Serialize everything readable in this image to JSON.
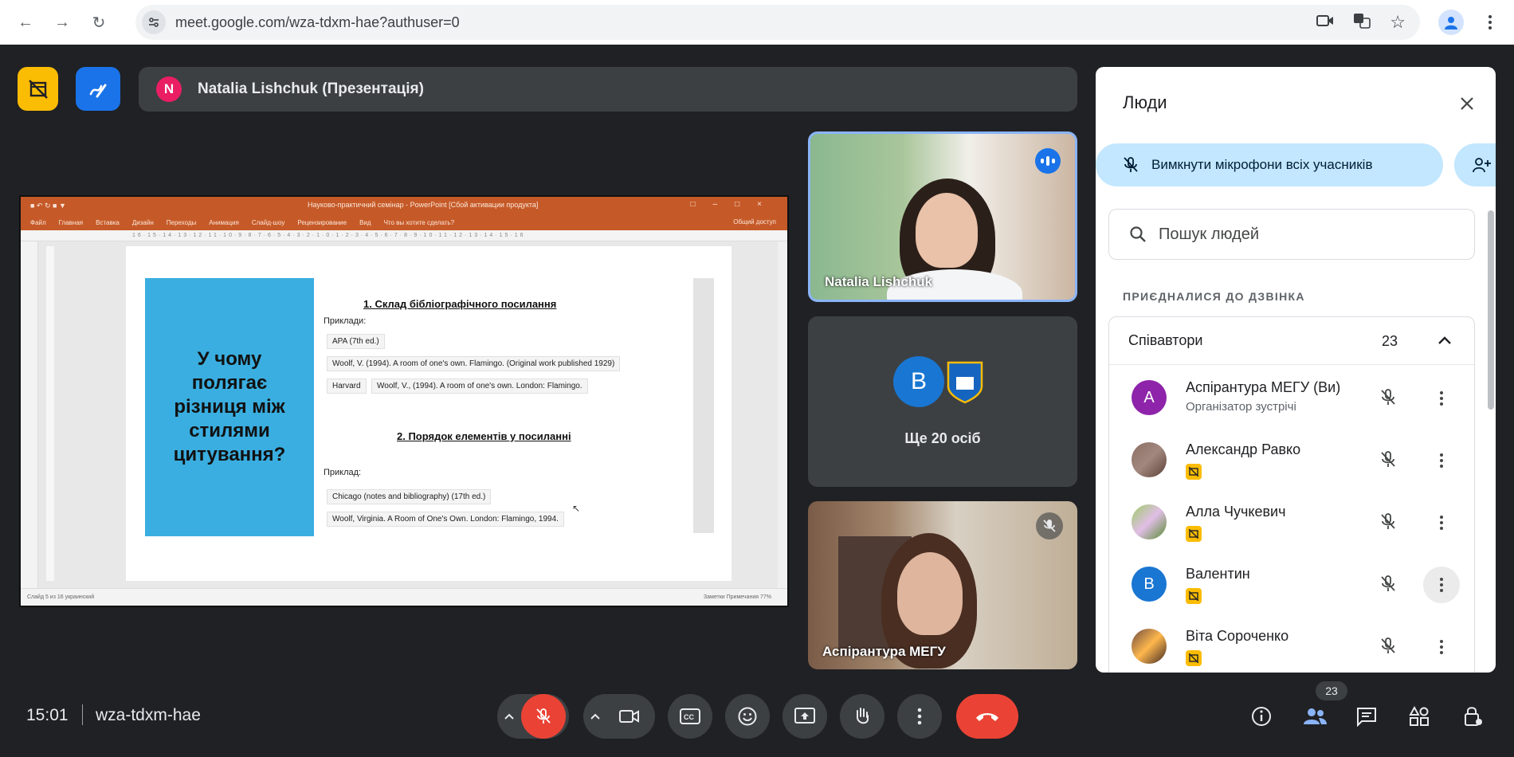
{
  "browser": {
    "url": "meet.google.com/wza-tdxm-hae?authuser=0"
  },
  "presenter": {
    "avatar_letter": "N",
    "label": "Natalia Lishchuk (Презентація)"
  },
  "slide": {
    "ppt_title": "Науково-практичний семінар - PowerPoint [Сбой активации продукта]",
    "ribbon_tabs": [
      "Файл",
      "Главная",
      "Вставка",
      "Дизайн",
      "Переходы",
      "Анимация",
      "Слайд-шоу",
      "Рецензирование",
      "Вид",
      "Что вы хотите сделать?"
    ],
    "share_label": "Общий доступ",
    "status_left": "Слайд 5 из 16   украинский",
    "status_right": "Заметки   Примечания   77%",
    "left_text": "У чому полягає різниця між стилями цитування?",
    "heading1": "1. Склад бібліографічного посилання",
    "examples_label": "Приклади:",
    "apa_label": "APA (7th ed.)",
    "apa_example": "Woolf, V. (1994). A room of one's own. Flamingo. (Original work published 1929)",
    "harvard_label": "Harvard",
    "harvard_example": "Woolf, V., (1994). A room of one's own. London: Flamingo.",
    "heading2": "2. Порядок елементів у посиланні",
    "example_label": "Приклад:",
    "chicago_label": "Chicago (notes and bibliography) (17th ed.)",
    "chicago_example": "Woolf, Virginia. A Room of One's Own. London: Flamingo, 1994."
  },
  "tiles": {
    "natalia": "Natalia Lishchuk",
    "more_letter": "B",
    "more_label": "Ще 20 осіб",
    "aspirantura": "Аспірантура МЕГУ"
  },
  "people_panel": {
    "title": "Люди",
    "mute_all": "Вимкнути мікрофони всіх учасників",
    "search_placeholder": "Пошук людей",
    "section": "ПРИЄДНАЛИСЯ ДО ДЗВІНКА",
    "group_title": "Співавтори",
    "group_count": "23",
    "participants": [
      {
        "name": "Аспірантура МЕГУ (Ви)",
        "subtitle": "Організатор зустрічі",
        "letter": "A",
        "color": "#8e24aa",
        "photo": false
      },
      {
        "name": "Александр Равко",
        "subtitle": "",
        "letter": "",
        "color": "#8d6e63",
        "photo": true
      },
      {
        "name": "Алла Чучкевич",
        "subtitle": "",
        "letter": "",
        "color": "#7cb342",
        "photo": true
      },
      {
        "name": "Валентин",
        "subtitle": "",
        "letter": "B",
        "color": "#1976d2",
        "photo": false
      },
      {
        "name": "Віта Сороченко",
        "subtitle": "",
        "letter": "",
        "color": "#6d4c41",
        "photo": true
      }
    ]
  },
  "bottom": {
    "time": "15:01",
    "meeting_code": "wza-tdxm-hae",
    "people_count": "23"
  },
  "colors": {
    "meet_bg": "#202124",
    "tile_bg": "#3c4043",
    "accent_blue": "#1a73e8",
    "danger_red": "#ea4335",
    "pill_blue": "#c2e7ff",
    "ppt_orange": "#c55a28"
  }
}
